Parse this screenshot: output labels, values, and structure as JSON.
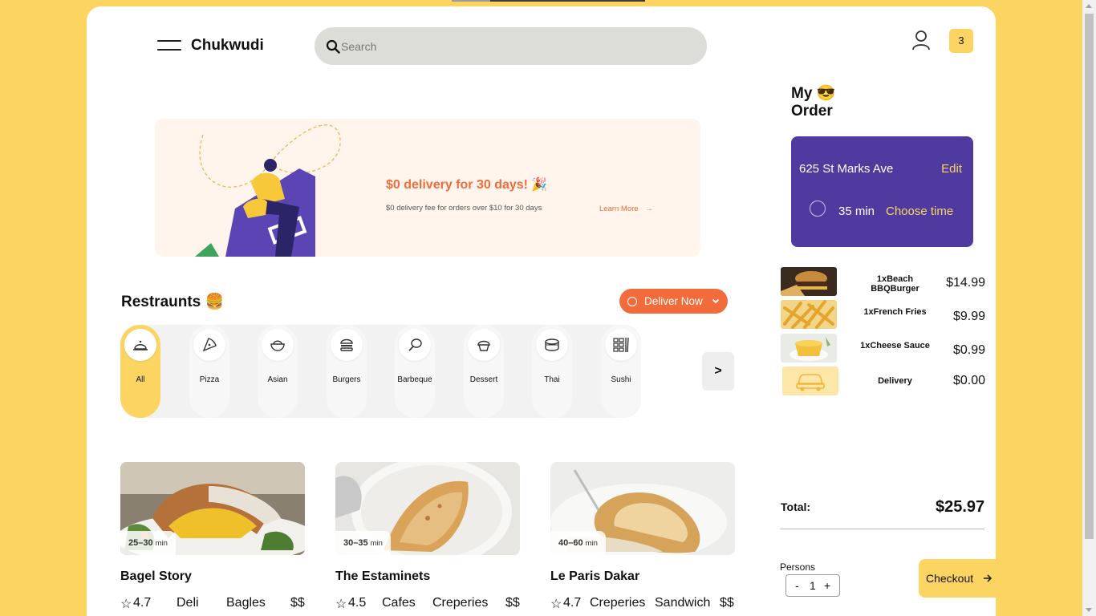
{
  "header": {
    "brand": "Chukwudi",
    "search_placeholder": "Search",
    "cart_count": "3"
  },
  "banner": {
    "title": "$0 delivery for 30 days! 🎉",
    "subtitle": "$0 delivery fee for orders over $10 for 30 days",
    "learn_more": "Learn More"
  },
  "restaurants": {
    "title": "Restraunts 🍔",
    "deliver_button": "Deliver Now",
    "categories": [
      {
        "label": "All",
        "icon": "cloche-icon"
      },
      {
        "label": "Pizza",
        "icon": "pizza-icon"
      },
      {
        "label": "Asian",
        "icon": "bowl-icon"
      },
      {
        "label": "Burgers",
        "icon": "burger-icon"
      },
      {
        "label": "Barbeque",
        "icon": "meat-icon"
      },
      {
        "label": "Dessert",
        "icon": "cupcake-icon"
      },
      {
        "label": "Thai",
        "icon": "dumpling-icon"
      },
      {
        "label": "Sushi",
        "icon": "sushi-icon"
      }
    ],
    "next_label": ">",
    "cards": [
      {
        "time": "25–30",
        "unit": "min",
        "name": "Bagel Story",
        "rating": "4.7",
        "tag1": "Deli",
        "tag2": "Bagles",
        "price": "$$"
      },
      {
        "time": "30–35",
        "unit": "min",
        "name": "The Estaminets",
        "rating": "4.5",
        "tag1": "Cafes",
        "tag2": "Creperies",
        "price": "$$"
      },
      {
        "time": "40–60",
        "unit": "min",
        "name": "Le Paris Dakar",
        "rating": "4.7",
        "tag1": "Creperies",
        "tag2": "Sandwich",
        "price": "$$"
      }
    ]
  },
  "order": {
    "title_line1": "My 😎",
    "title_line2": "Order",
    "address": "625 St Marks Ave",
    "edit": "Edit",
    "minutes": "35 min",
    "choose_time": "Choose time",
    "items": [
      {
        "name": "1xBeach BBQBurger",
        "price": "$14.99"
      },
      {
        "name": "1xFrench Fries",
        "price": "$9.99"
      },
      {
        "name": "1xCheese Sauce",
        "price": "$0.99"
      },
      {
        "name": "Delivery",
        "price": "$0.00"
      }
    ],
    "total_label": "Total:",
    "total_value": "$25.97",
    "persons_label": "Persons",
    "persons_minus": "-",
    "persons_count": "1",
    "persons_plus": "+",
    "checkout": "Checkout"
  },
  "colors": {
    "accent_yellow": "#FCD462",
    "accent_orange": "#F26B3A",
    "panel_purple": "#4F3BA0"
  }
}
